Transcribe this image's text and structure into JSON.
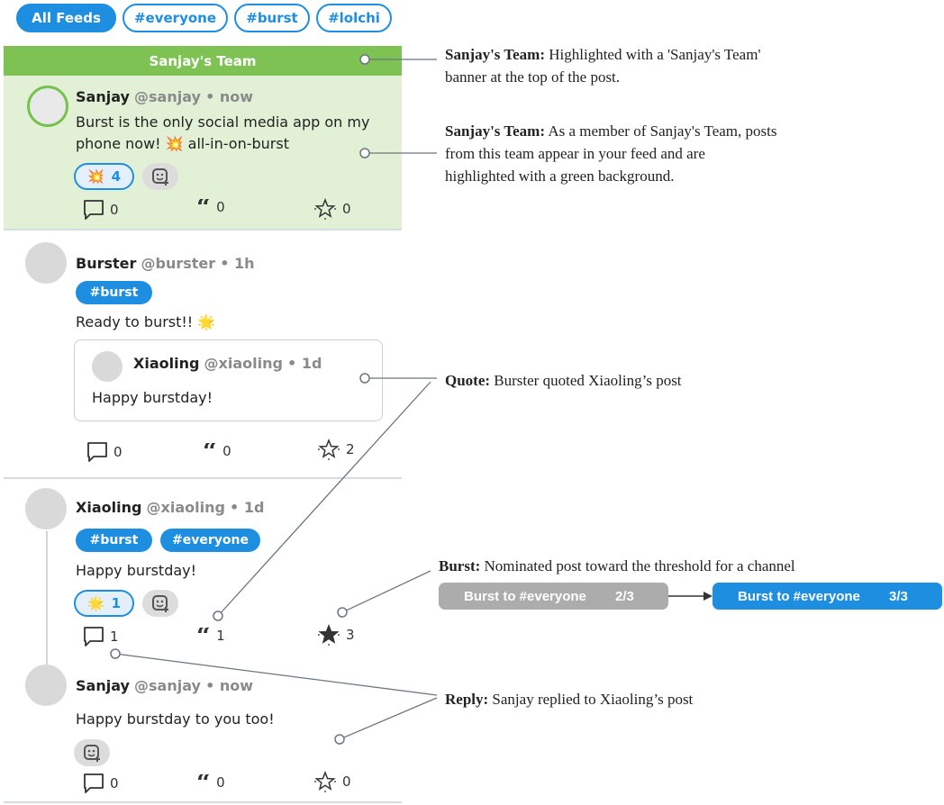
{
  "tabs": [
    "All Feeds",
    "#everyone",
    "#burst",
    "#lolchi"
  ],
  "team_banner": "Sanjay's Team",
  "posts": [
    {
      "name": "Sanjay",
      "handle": "@sanjay",
      "time": "• now",
      "lines": [
        "Burst is the only social media app on my",
        "phone now! 💥 all-in-on-burst"
      ],
      "reaction": {
        "emoji": "💥",
        "count": "4"
      },
      "replies": "0",
      "quotes": "0",
      "bursts": "0"
    },
    {
      "name": "Burster",
      "handle": "@burster",
      "time": "• 1h",
      "tags": [
        "#burst"
      ],
      "text": "Ready to burst!! 🌟",
      "quoted": {
        "name": "Xiaoling",
        "handle": "@xiaoling",
        "time": "• 1d",
        "text": "Happy burstday!"
      },
      "replies": "0",
      "quotes": "0",
      "bursts": "2"
    },
    {
      "name": "Xiaoling",
      "handle": "@xiaoling",
      "time": "• 1d",
      "tags": [
        "#burst",
        "#everyone"
      ],
      "text": "Happy burstday!",
      "reaction": {
        "emoji": "🌟",
        "count": "1"
      },
      "replies": "1",
      "quotes": "1",
      "bursts": "3"
    },
    {
      "name": "Sanjay",
      "handle": "@sanjay",
      "time": "• now",
      "text": "Happy burstday to you too!",
      "replies": "0",
      "quotes": "0",
      "bursts": "0"
    }
  ],
  "annotations": {
    "team_banner": {
      "label": "Sanjay's Team:",
      "lines": [
        "Highlighted with a 'Sanjay's Team'",
        "banner at the top of the post."
      ]
    },
    "team_bg": {
      "label": "Sanjay's Team:",
      "lines": [
        "As a member of Sanjay's Team, posts",
        "from this team appear in your feed and are",
        "highlighted with a green background."
      ]
    },
    "quote": {
      "label": "Quote:",
      "text": "Burster quoted Xiaoling’s post"
    },
    "burst": {
      "label": "Burst:",
      "text": "Nominated post toward the threshold for a channel"
    },
    "reply": {
      "label": "Reply:",
      "text": "Sanjay replied to Xiaoling’s post"
    }
  },
  "burst_pills": [
    {
      "label": "Burst to #everyone",
      "count": "2/3",
      "color": "#acacac"
    },
    {
      "label": "Burst to #everyone",
      "count": "3/3",
      "color": "#1e8fe0"
    }
  ],
  "colors": {
    "accent": "#1e8fe0",
    "team_green": "#7ec253",
    "team_bg": "#e2f1d6"
  }
}
